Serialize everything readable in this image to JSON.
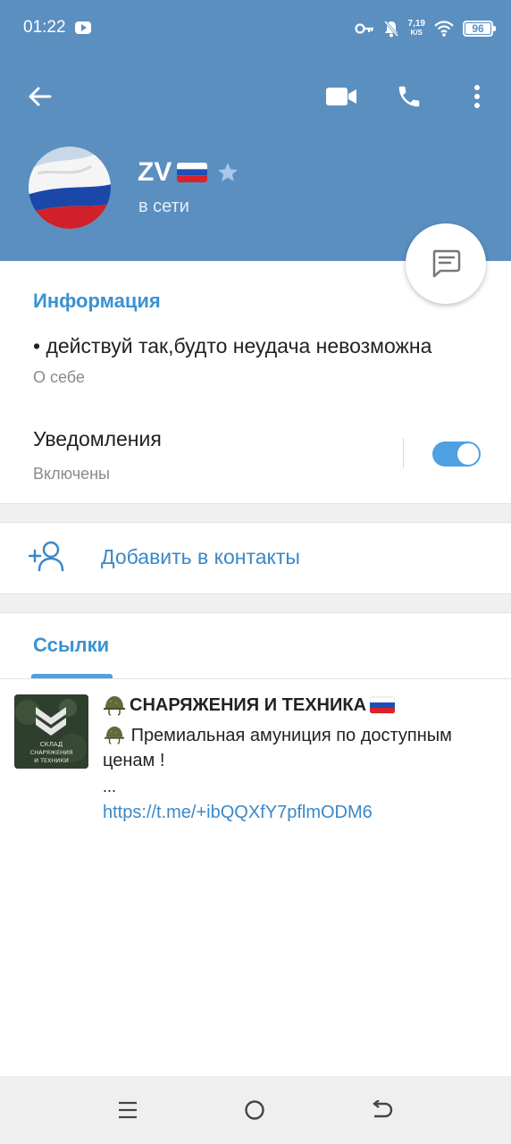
{
  "status_bar": {
    "time": "01:22",
    "speed_value": "7,19",
    "speed_unit": "K/S",
    "battery": "96"
  },
  "profile": {
    "name": "ZV",
    "status": "в сети"
  },
  "info": {
    "section_title": "Информация",
    "bio": "• действуй так,будто неудача невозможна",
    "bio_label": "О себе",
    "notifications_label": "Уведомления",
    "notifications_status": "Включены"
  },
  "actions": {
    "add_contact": "Добавить в контакты"
  },
  "tabs": {
    "links": "Ссылки"
  },
  "link": {
    "title": "СНАРЯЖЕНИЯ И ТЕХНИКА",
    "description": "Премиальная амуниция по доступным ценам !",
    "ellipsis": "...",
    "url": "https://t.me/+ibQQXfY7pflmODM6",
    "thumb_text_1": "СКЛАД",
    "thumb_text_2": "СНАРЯЖЕНИЯ",
    "thumb_text_3": "И ТЕХНИКИ"
  },
  "colors": {
    "header": "#5b8fc0",
    "accent": "#3a92d2",
    "link": "#3a88c8"
  },
  "icons": [
    "back-arrow-icon",
    "video-call-icon",
    "phone-icon",
    "more-vertical-icon",
    "message-icon",
    "add-user-icon",
    "helmet-icon",
    "russia-flag-icon",
    "star-icon"
  ]
}
